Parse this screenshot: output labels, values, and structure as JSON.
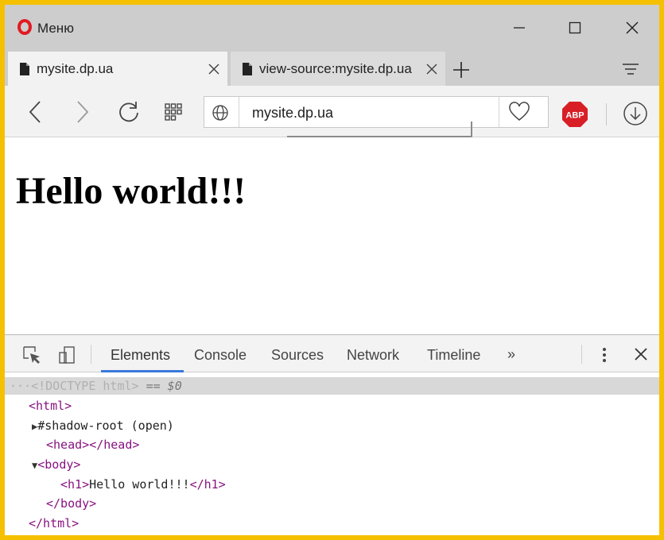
{
  "window": {
    "menu_label": "Меню",
    "controls": {
      "minimize_icon": "minimize-icon",
      "maximize_icon": "maximize-icon",
      "close_icon": "close-icon"
    }
  },
  "tabs": [
    {
      "label": "mysite.dp.ua",
      "active": true
    },
    {
      "label": "view-source:mysite.dp.ua",
      "active": false
    }
  ],
  "address_bar": {
    "url": "mysite.dp.ua"
  },
  "extensions": {
    "abp_label": "ABP"
  },
  "page": {
    "heading": "Hello world!!!"
  },
  "devtools": {
    "tabs": [
      "Elements",
      "Console",
      "Sources",
      "Network",
      "Timeline"
    ],
    "active_tab": "Elements",
    "more_tabs": "»",
    "dom": {
      "selected_line": "<!DOCTYPE html>",
      "selected_suffix": "== $0",
      "dots": "···",
      "html_open": "<html>",
      "shadow_root": "#shadow-root (open)",
      "head_open": "<head>",
      "head_close": "</head>",
      "body_open": "<body>",
      "h1_open": "<h1>",
      "h1_text": "Hello world!!!",
      "h1_close": "</h1>",
      "body_close": "</body>",
      "html_close": "</html>"
    }
  },
  "colors": {
    "frame": "#f5c000",
    "opera_red": "#e01b22",
    "active_tab_underline": "#3879d9",
    "tag": "#881280"
  }
}
